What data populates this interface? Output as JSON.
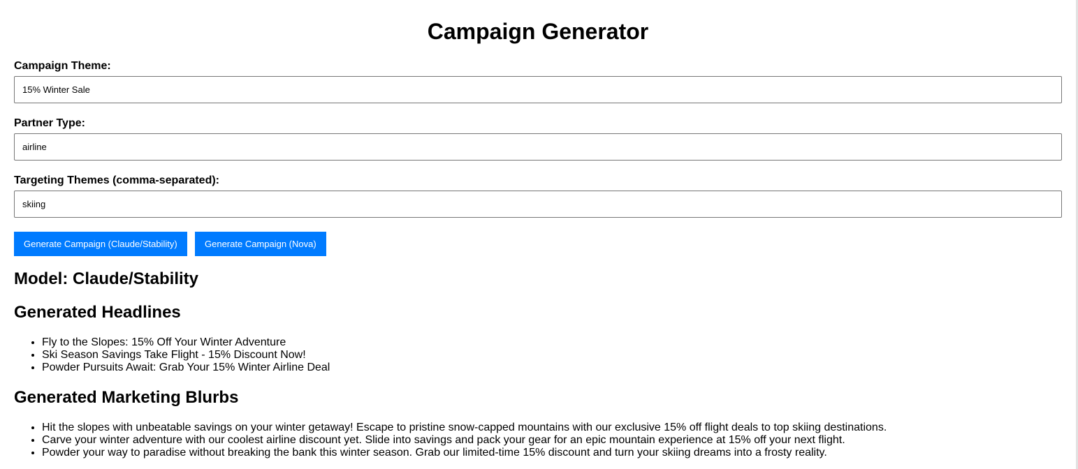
{
  "page": {
    "title": "Campaign Generator"
  },
  "form": {
    "theme_label": "Campaign Theme:",
    "theme_value": "15% Winter Sale",
    "partner_label": "Partner Type:",
    "partner_value": "airline",
    "targeting_label": "Targeting Themes (comma-separated):",
    "targeting_value": "skiing"
  },
  "buttons": {
    "claude_label": "Generate Campaign (Claude/Stability)",
    "nova_label": "Generate Campaign (Nova)"
  },
  "results": {
    "model_heading": "Model: Claude/Stability",
    "headlines_heading": "Generated Headlines",
    "headlines": [
      "Fly to the Slopes: 15% Off Your Winter Adventure",
      "Ski Season Savings Take Flight - 15% Discount Now!",
      "Powder Pursuits Await: Grab Your 15% Winter Airline Deal"
    ],
    "blurbs_heading": "Generated Marketing Blurbs",
    "blurbs": [
      "Hit the slopes with unbeatable savings on your winter getaway! Escape to pristine snow-capped mountains with our exclusive 15% off flight deals to top skiing destinations.",
      "Carve your winter adventure with our coolest airline discount yet. Slide into savings and pack your gear for an epic mountain experience at 15% off your next flight.",
      "Powder your way to paradise without breaking the bank this winter season. Grab our limited-time 15% discount and turn your skiing dreams into a frosty reality."
    ]
  },
  "colors": {
    "button_bg": "#007bff",
    "button_text": "#ffffff"
  }
}
